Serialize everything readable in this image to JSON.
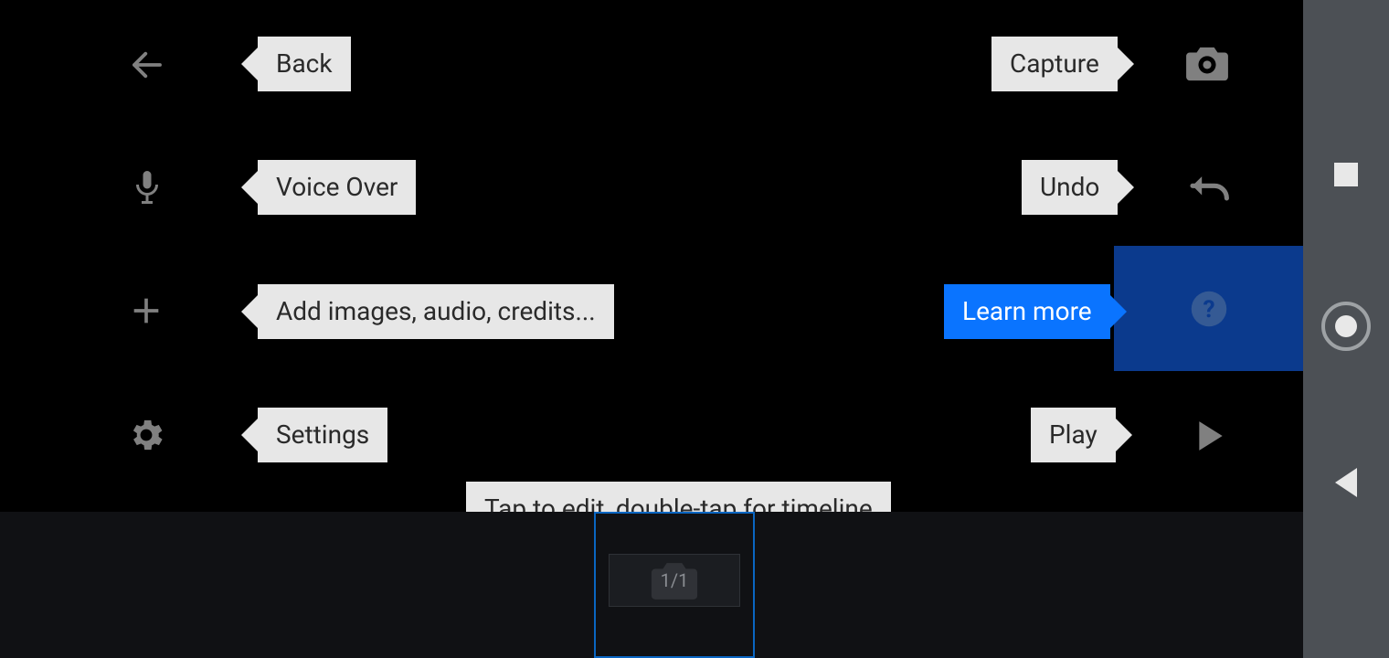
{
  "labels": {
    "back": "Back",
    "voice_over": "Voice Over",
    "add": "Add images, audio, credits...",
    "settings": "Settings",
    "capture": "Capture",
    "undo": "Undo",
    "learn_more": "Learn more",
    "play": "Play",
    "timeline_hint": "Tap to edit, double-tap for timeline"
  },
  "timeline": {
    "frame_counter": "1/1"
  }
}
